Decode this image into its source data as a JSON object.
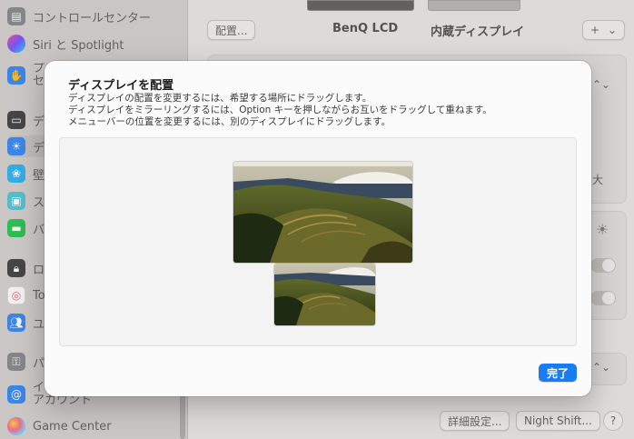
{
  "sidebar": {
    "items": [
      {
        "label": "コントロールセンター",
        "icon": "control-center-icon",
        "color": "#8e8e93"
      },
      {
        "label": "Siri と Spotlight",
        "icon": "siri-icon",
        "color": "#7a5cff"
      },
      {
        "label": "プ\nセ",
        "icon": "privacy-hand-icon",
        "color": "#3f8ef7"
      },
      {
        "label": "デ",
        "icon": "desktop-dock-icon",
        "color": "#4a4a4c"
      },
      {
        "label": "デ",
        "icon": "displays-icon",
        "color": "#3f8ef7"
      },
      {
        "label": "壁",
        "icon": "wallpaper-icon",
        "color": "#38b6f5"
      },
      {
        "label": "ス",
        "icon": "screensaver-icon",
        "color": "#5ac8d8"
      },
      {
        "label": "バ",
        "icon": "battery-icon",
        "color": "#34c759"
      },
      {
        "label": "ロ",
        "icon": "lock-icon",
        "color": "#4a4a4c"
      },
      {
        "label": "To",
        "icon": "touch-id-icon",
        "color": "#ff5e7a"
      },
      {
        "label": "ユ",
        "icon": "users-icon",
        "color": "#3f8ef7"
      },
      {
        "label": "パ",
        "icon": "passwords-icon",
        "color": "#8e8e93"
      },
      {
        "label": "イ\nアカウント",
        "icon": "internet-accounts-icon",
        "color": "#3f8ef7"
      },
      {
        "label": "Game Center",
        "icon": "game-center-icon",
        "color": "#d9d9d9"
      }
    ]
  },
  "main": {
    "arrange_button": "配置...",
    "display_1": "BenQ LCD",
    "display_2": "内蔵ディスプレイ",
    "add_button": "+",
    "add_chevron": "⌄",
    "partial_right_1": "大",
    "advanced_button": "詳細設定...",
    "night_shift_button": "Night Shift...",
    "help_button": "?"
  },
  "modal": {
    "title": "ディスプレイを配置",
    "desc_1": "ディスプレイの配置を変更するには、希望する場所にドラッグします。",
    "desc_2": "ディスプレイをミラーリングするには、Option キーを押しながらお互いをドラッグして重ねます。",
    "desc_3": "メニューバーの位置を変更するには、別のディスプレイにドラッグします。",
    "done_button": "完了"
  },
  "colors": {
    "accent": "#1a7cf5"
  }
}
